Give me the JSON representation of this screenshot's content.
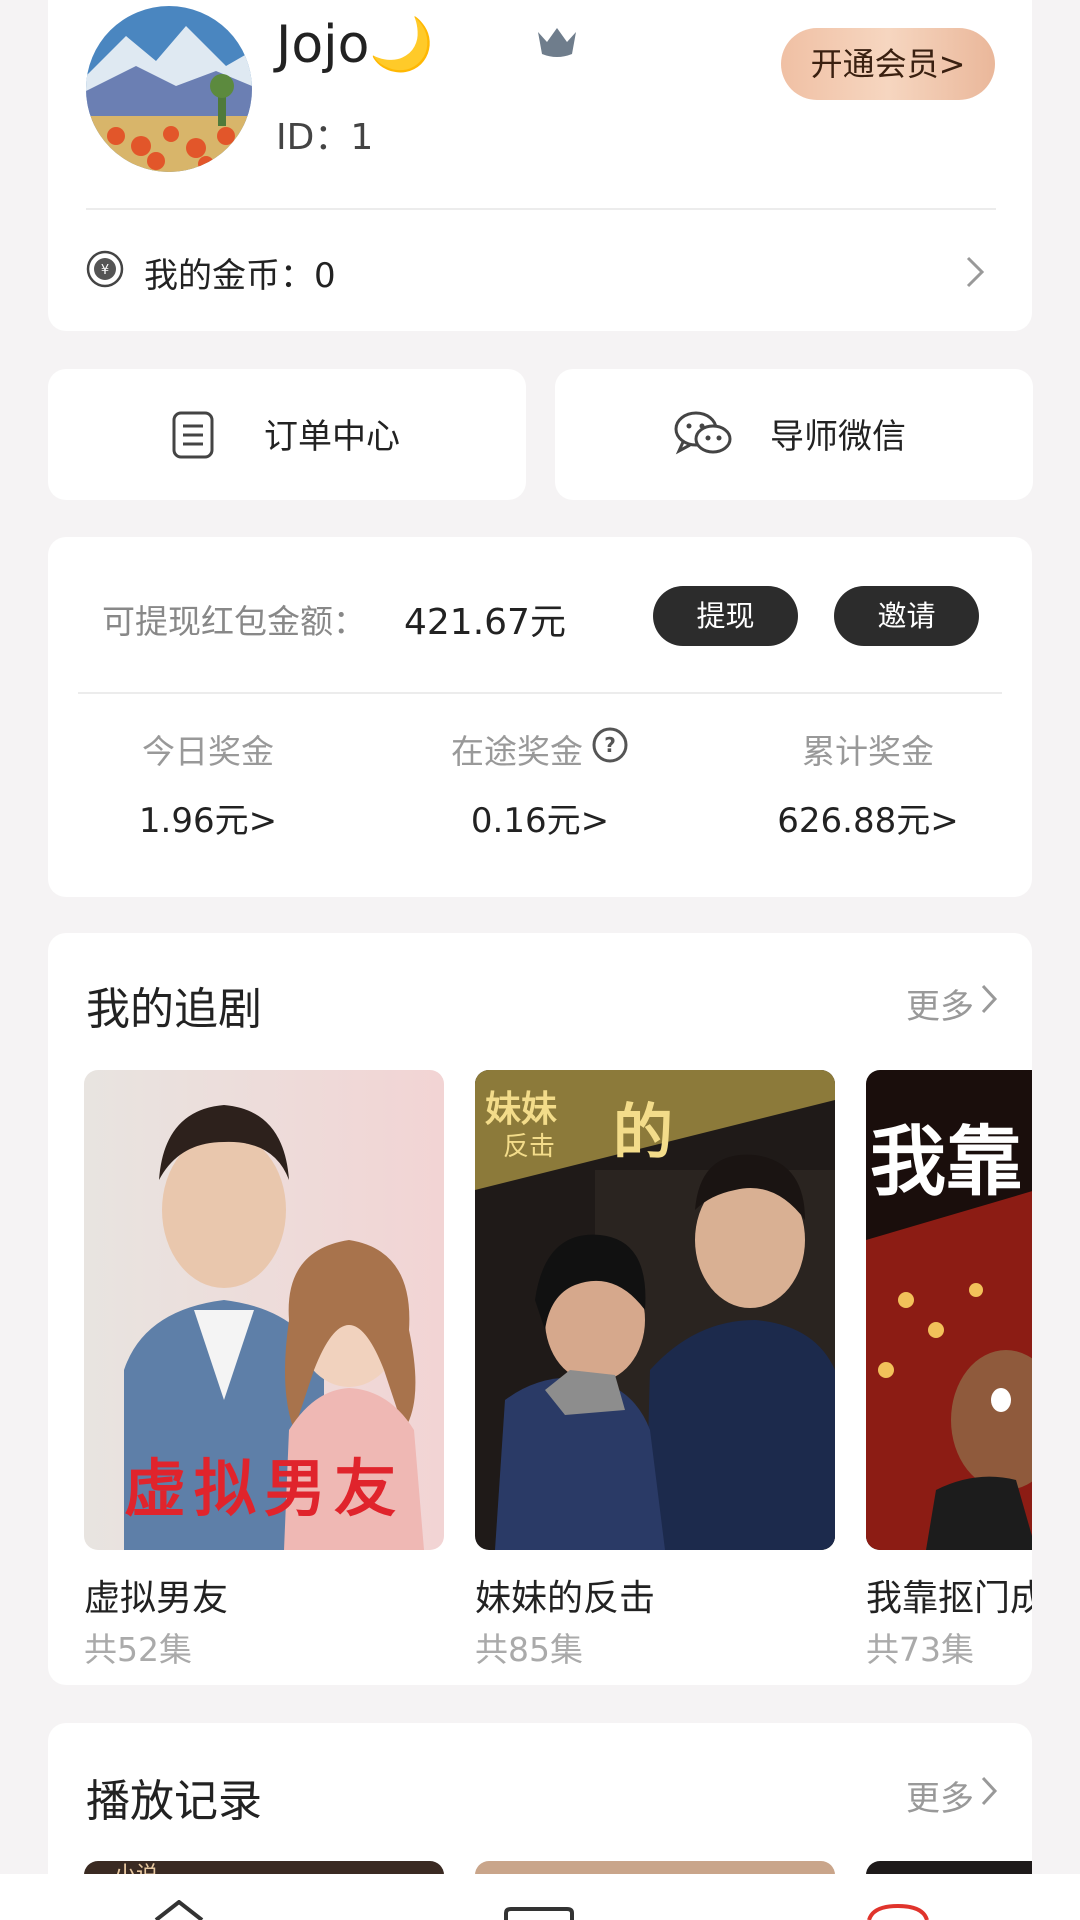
{
  "profile": {
    "username": "Jojo🌙",
    "user_id": "ID：1",
    "vip_button": "开通会员>",
    "coins_label": "我的金币：0"
  },
  "actions": {
    "orders": "订单中心",
    "mentor_wechat": "导师微信"
  },
  "earnings": {
    "withdrawable_label": "可提现红包金额：",
    "withdrawable_amount": "421.67元",
    "withdraw_button": "提现",
    "invite_button": "邀请",
    "stats": [
      {
        "label": "今日奖金",
        "value": "1.96元>"
      },
      {
        "label": "在途奖金",
        "value": "0.16元>"
      },
      {
        "label": "累计奖金",
        "value": "626.88元>"
      }
    ]
  },
  "my_dramas": {
    "title": "我的追剧",
    "more": "更多",
    "items": [
      {
        "title": "虚拟男友",
        "episodes": "共52集",
        "poster_text": "虚拟男友"
      },
      {
        "title": "妹妹的反击",
        "episodes": "共85集",
        "poster_text_top": "妹妹",
        "poster_text_sub": "反击",
        "poster_text_big": "的"
      },
      {
        "title": "我靠抠门成",
        "episodes": "共73集",
        "poster_text": "我靠"
      }
    ]
  },
  "history": {
    "title": "播放记录",
    "more": "更多",
    "thumb_text": "小说"
  },
  "colors": {
    "background": "#f5f3f4",
    "card": "#ffffff",
    "pill": "#2c2c2c",
    "vip_gradient_start": "#f0c0a4"
  }
}
